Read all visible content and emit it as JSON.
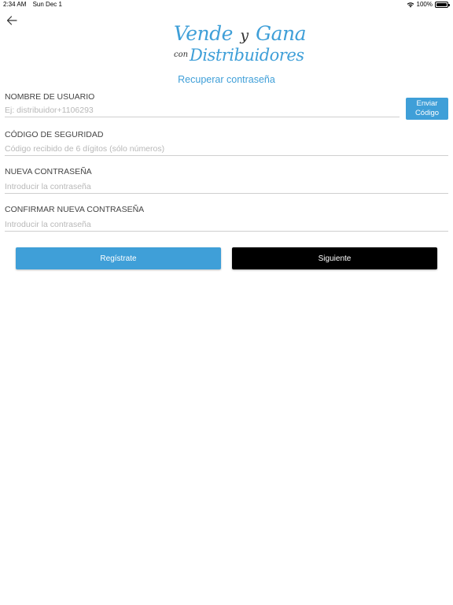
{
  "status_bar": {
    "time": "2:34 AM",
    "date": "Sun Dec 1",
    "battery": "100%"
  },
  "logo": {
    "word1": "Vende",
    "word2": "y",
    "word3": "Gana",
    "word4": "con",
    "word5": "Distribuidores"
  },
  "page_title": "Recuperar contraseña",
  "form": {
    "username": {
      "label": "NOMBRE DE USUARIO",
      "placeholder": "Ej: distribuidor+1106293",
      "value": ""
    },
    "send_code_label": "Enviar\nCódigo",
    "security_code": {
      "label": "CÓDIGO DE SEGURIDAD",
      "placeholder": "Código recibido de 6 dígitos (sólo números)",
      "value": ""
    },
    "new_password": {
      "label": "NUEVA CONTRASEÑA",
      "placeholder": "Introducir la contraseña",
      "value": ""
    },
    "confirm_password": {
      "label": "CONFIRMAR NUEVA CONTRASEÑA",
      "placeholder": "Introducir la contraseña",
      "value": ""
    }
  },
  "buttons": {
    "register": "Regístrate",
    "next": "Siguiente"
  },
  "colors": {
    "accent": "#3f9fd8",
    "primary_dark": "#000000"
  },
  "icons": {
    "back": "arrow-left-icon",
    "wifi": "wifi-icon",
    "battery": "battery-icon"
  }
}
